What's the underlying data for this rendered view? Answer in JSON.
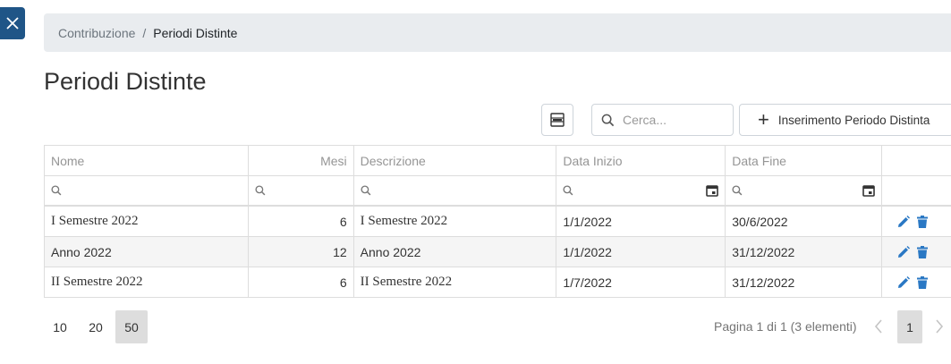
{
  "breadcrumb": {
    "parent": "Contribuzione",
    "separator": "/",
    "current": "Periodi Distinte"
  },
  "page_title": "Periodi Distinte",
  "toolbar": {
    "search_placeholder": "Cerca...",
    "add_label": "Inserimento Periodo Distinta",
    "export_icon": "excel-export-icon"
  },
  "grid": {
    "columns": {
      "nome": "Nome",
      "mesi": "Mesi",
      "descrizione": "Descrizione",
      "data_inizio": "Data Inizio",
      "data_fine": "Data Fine"
    },
    "rows": [
      {
        "nome": "I Semestre 2022",
        "mesi": "6",
        "descrizione": "I Semestre 2022",
        "data_inizio": "1/1/2022",
        "data_fine": "30/6/2022"
      },
      {
        "nome": "Anno 2022",
        "mesi": "12",
        "descrizione": "Anno 2022",
        "data_inizio": "1/1/2022",
        "data_fine": "31/12/2022"
      },
      {
        "nome": "II Semestre 2022",
        "mesi": "6",
        "descrizione": "II Semestre 2022",
        "data_inizio": "1/7/2022",
        "data_fine": "31/12/2022"
      }
    ]
  },
  "pager": {
    "page_sizes": [
      "10",
      "20",
      "50"
    ],
    "selected_page_size": "50",
    "info": "Pagina 1 di 1 (3 elementi)",
    "current_page": "1"
  },
  "colors": {
    "accent": "#1f5587",
    "action_icon": "#2a78c4",
    "breadcrumb_bg": "#e9ecef"
  }
}
